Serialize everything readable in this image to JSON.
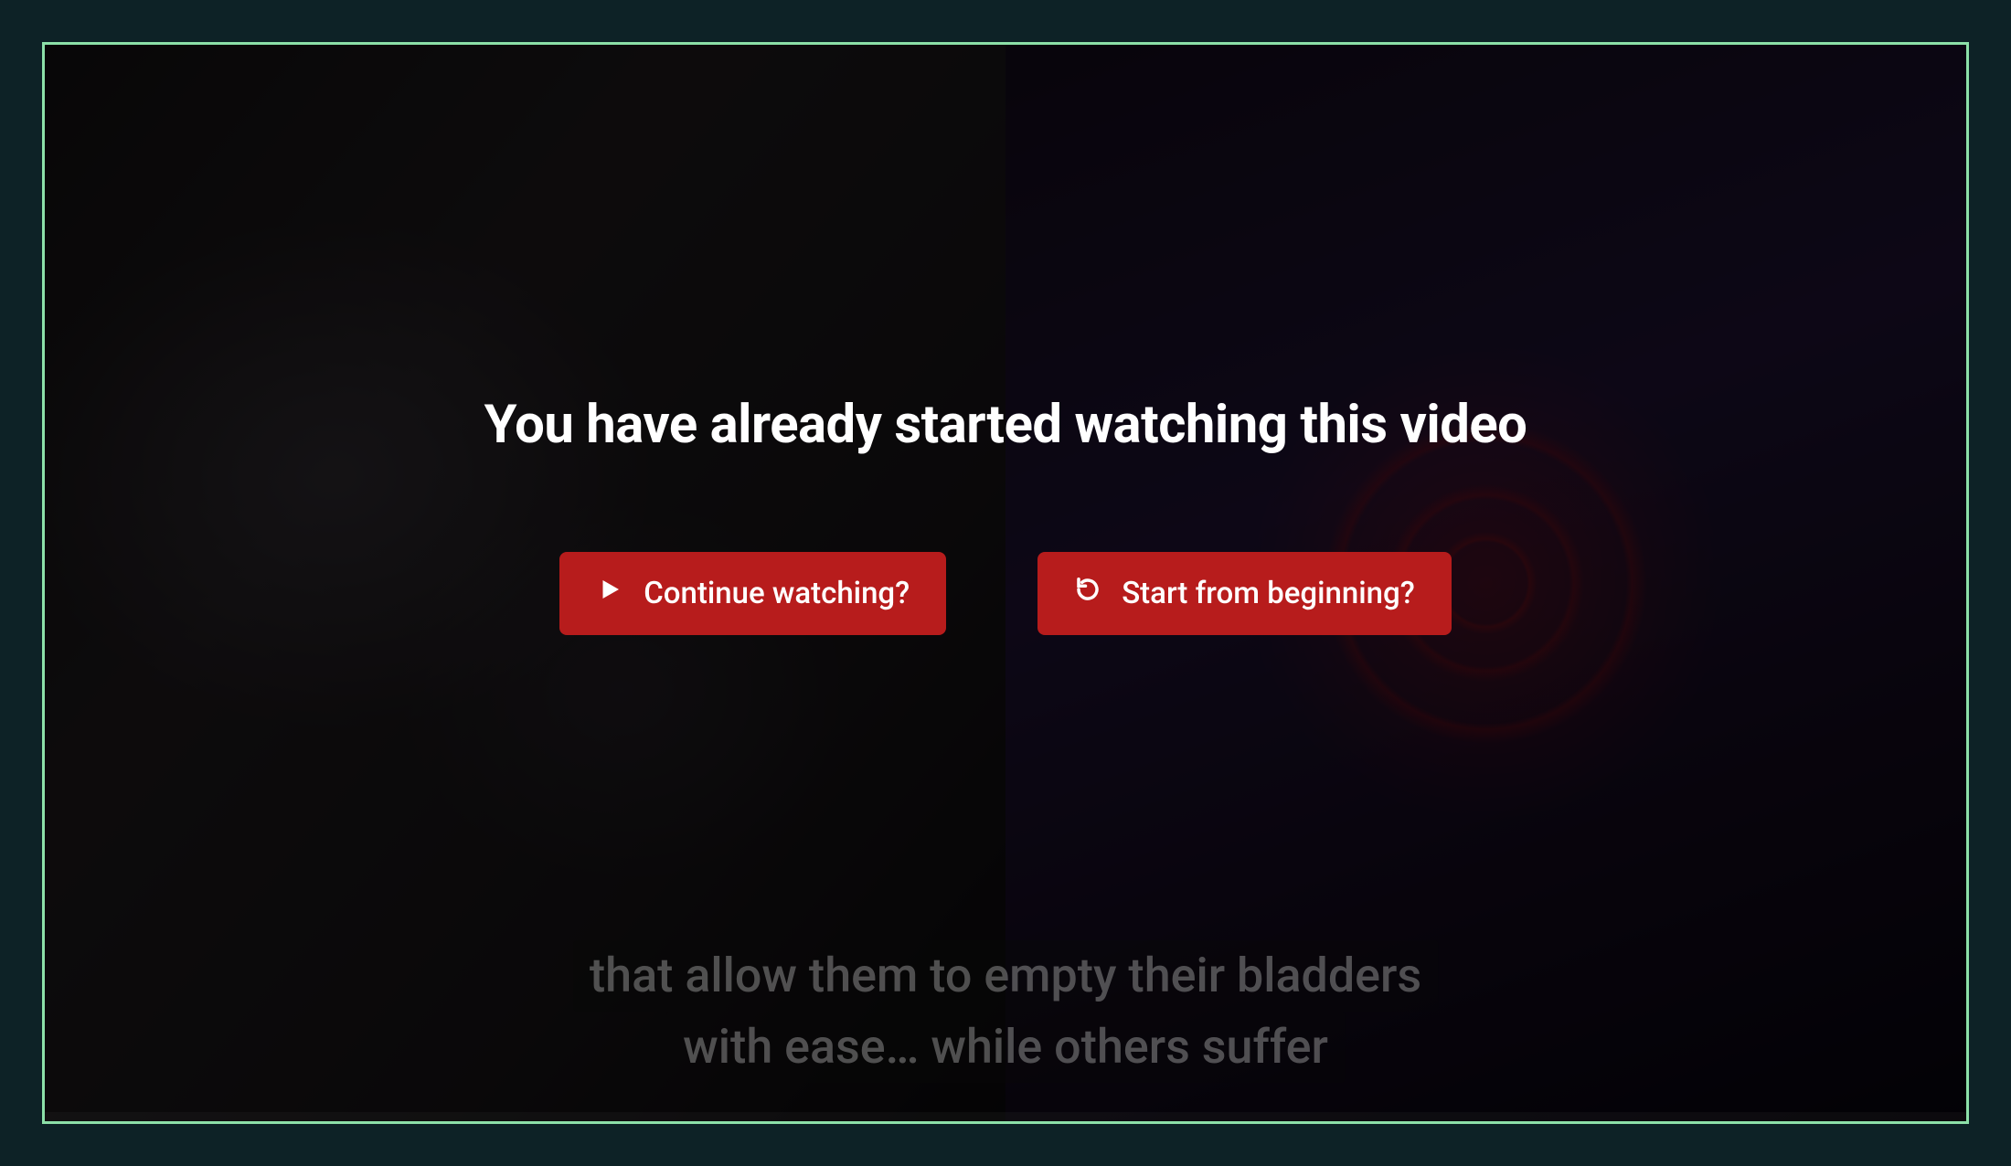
{
  "dialog": {
    "title": "You have already started watching this video",
    "continue_label": "Continue watching?",
    "restart_label": "Start from beginning?"
  },
  "subtitle": {
    "line1": "that allow them to empty their bladders",
    "line2": "with ease… while others suffer"
  },
  "colors": {
    "button_bg": "#b71c1c",
    "frame_border": "#8ce0a8",
    "page_bg": "#0d2226"
  },
  "icons": {
    "play": "play-icon",
    "restart": "restart-icon"
  }
}
